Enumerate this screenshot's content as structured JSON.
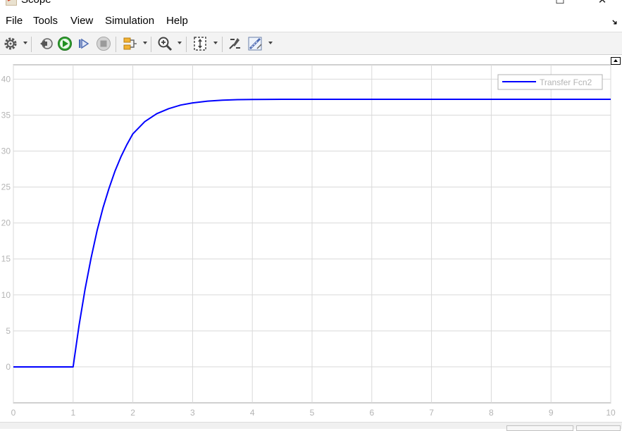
{
  "window": {
    "title": "Scope",
    "maximize_glyph": "☐",
    "close_glyph": "✕"
  },
  "menu": {
    "items": [
      "File",
      "Tools",
      "View",
      "Simulation",
      "Help"
    ],
    "collapse_glyph": "➜"
  },
  "toolbar": {
    "icons": [
      "gear-icon",
      "step-back-icon",
      "run-icon",
      "step-forward-icon",
      "stop-icon",
      "signal-selector-icon",
      "zoom-icon",
      "autoscale-icon",
      "style-icon",
      "measure-icon"
    ]
  },
  "colors": {
    "series": "#0000ff",
    "grid": "#d9d9d9",
    "tick_text": "#b4b4b4",
    "legend_text": "#b4b4b4"
  },
  "chart_data": {
    "type": "line",
    "title": "",
    "xlabel": "",
    "ylabel": "",
    "xlim": [
      0,
      10
    ],
    "ylim": [
      -5,
      42
    ],
    "grid": true,
    "legend_position": "top-right",
    "x_ticks": [
      "0",
      "1",
      "2",
      "3",
      "4",
      "5",
      "6",
      "7",
      "8",
      "9",
      "10"
    ],
    "y_ticks": [
      "0",
      "5",
      "10",
      "15",
      "20",
      "25",
      "30",
      "35",
      "40"
    ],
    "series": [
      {
        "name": "Transfer Fcn2",
        "x": [
          0,
          1,
          1.1,
          1.2,
          1.3,
          1.4,
          1.5,
          1.6,
          1.7,
          1.8,
          1.9,
          2.0,
          2.2,
          2.4,
          2.6,
          2.8,
          3.0,
          3.25,
          3.5,
          3.75,
          4.0,
          4.5,
          5.0,
          6.0,
          7.0,
          8.0,
          9.0,
          10.0
        ],
        "y": [
          0,
          0,
          5.8,
          10.8,
          15.1,
          18.9,
          22.1,
          24.8,
          27.2,
          29.2,
          30.9,
          32.4,
          34.1,
          35.2,
          35.9,
          36.4,
          36.7,
          36.95,
          37.08,
          37.15,
          37.18,
          37.2,
          37.2,
          37.2,
          37.2,
          37.2,
          37.2,
          37.2
        ]
      }
    ]
  }
}
